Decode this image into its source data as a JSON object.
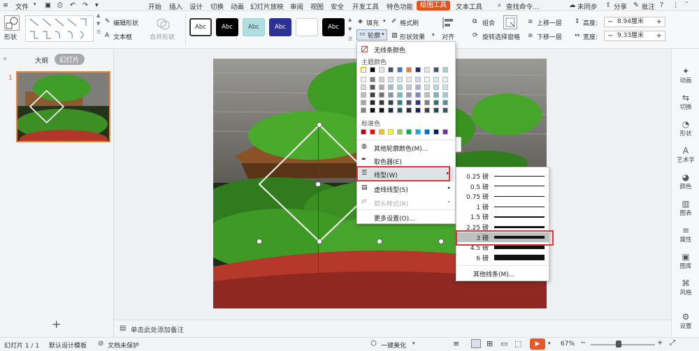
{
  "menubar": {
    "file": "文件",
    "items": [
      "开始",
      "插入",
      "设计",
      "切换",
      "动画",
      "幻灯片放映",
      "审阅",
      "视图",
      "安全",
      "开发工具",
      "特色功能",
      "绘图工具",
      "文本工具"
    ],
    "search": "查找命令...",
    "sync": "未同步",
    "share": "分享",
    "comment": "批注",
    "help": "?"
  },
  "ribbon": {
    "shape": "形状",
    "edit_shape": "编辑形状",
    "textbox": "文本框",
    "merge_shape": "合并形状",
    "style_label": "Abc",
    "fill": "填充",
    "format_painter": "格式刷",
    "outline": "轮廓",
    "shape_effect": "形状效果",
    "align": "对齐",
    "group": "组合",
    "rotate": "旋转",
    "selection_pane": "选择窗格",
    "bring_forward": "上移一层",
    "send_backward": "下移一层",
    "height_label": "高度:",
    "height_value": "8.94厘米",
    "width_label": "宽度:",
    "width_value": "9.33厘米"
  },
  "left_panel": {
    "outline_tab": "大纲",
    "slides_tab": "幻灯片",
    "slide_number": "1",
    "add": "+"
  },
  "right_bar": [
    "动画",
    "切换",
    "形状",
    "艺术字",
    "颜色",
    "图表",
    "属性",
    "图库",
    "风格",
    "设置"
  ],
  "notes": "单击此处添加备注",
  "status": {
    "slide": "幻灯片 1 / 1",
    "template": "默认设计模板",
    "protect": "文档未保护",
    "beautify": "一键美化",
    "zoom": "67%"
  },
  "outline_menu": {
    "no_line": "无线条颜色",
    "theme_colors": "主题颜色",
    "standard_colors": "标准色",
    "more_colors": "其他轮廓颜色(M)...",
    "eyedropper": "取色器(E)",
    "line_type": "线型(W)",
    "dash_type": "虚线线型(S)",
    "arrow_style": "箭头样式(R)",
    "more_settings": "更多设置(O)...",
    "theme_top": [
      "#ffffff",
      "#000000",
      "#e7e6e6",
      "#44546a",
      "#4472c4",
      "#ed7d31",
      "#1f2d6e",
      "#dbe7f0",
      "#44546a",
      "#9ecfd6"
    ],
    "theme_cols": [
      [
        "#f2f2f2",
        "#d9d9d9",
        "#bfbfbf",
        "#a6a6a6",
        "#808080"
      ],
      [
        "#7f7f7f",
        "#595959",
        "#404040",
        "#262626",
        "#0d0d0d"
      ],
      [
        "#d0cece",
        "#aeaaaa",
        "#757171",
        "#3a3838",
        "#171616"
      ],
      [
        "#d6dce4",
        "#adb9ca",
        "#8497b0",
        "#333f4f",
        "#222a35"
      ],
      [
        "#cde9ec",
        "#9bd3d9",
        "#69bdc6",
        "#2f7f88",
        "#1f555a"
      ],
      [
        "#e8e8f0",
        "#c8c8dc",
        "#9999bb",
        "#4b4b78",
        "#2a2a4a"
      ],
      [
        "#d3d6ee",
        "#a7addd",
        "#7b84cc",
        "#2a3190",
        "#1c2160"
      ],
      [
        "#f2f2f2",
        "#d9d9d9",
        "#bfbfbf",
        "#7f7f7f",
        "#404040"
      ],
      [
        "#d6f0f0",
        "#add8e6",
        "#6fb7c7",
        "#2f6f7f",
        "#1f4a55"
      ],
      [
        "#e4f1f7",
        "#c8e3ef",
        "#9ccbdf",
        "#4d8fa8",
        "#2e5a6b"
      ]
    ],
    "standard": [
      "#c00000",
      "#ff0000",
      "#ffc000",
      "#ffff00",
      "#92d050",
      "#00b050",
      "#00b0f0",
      "#0070c0",
      "#002060",
      "#7030a0"
    ]
  },
  "weight_menu": {
    "items": [
      {
        "label": "0.25 磅",
        "weight": 0.25
      },
      {
        "label": "0.5 磅",
        "weight": 0.5
      },
      {
        "label": "0.75 磅",
        "weight": 0.75
      },
      {
        "label": "1 磅",
        "weight": 1
      },
      {
        "label": "1.5 磅",
        "weight": 1.5
      },
      {
        "label": "2.25 磅",
        "weight": 2.25
      },
      {
        "label": "3 磅",
        "weight": 3
      },
      {
        "label": "4.5 磅",
        "weight": 4.5
      },
      {
        "label": "6 磅",
        "weight": 6
      }
    ],
    "selected": "3 磅",
    "more_lines": "其他线条(M)..."
  }
}
